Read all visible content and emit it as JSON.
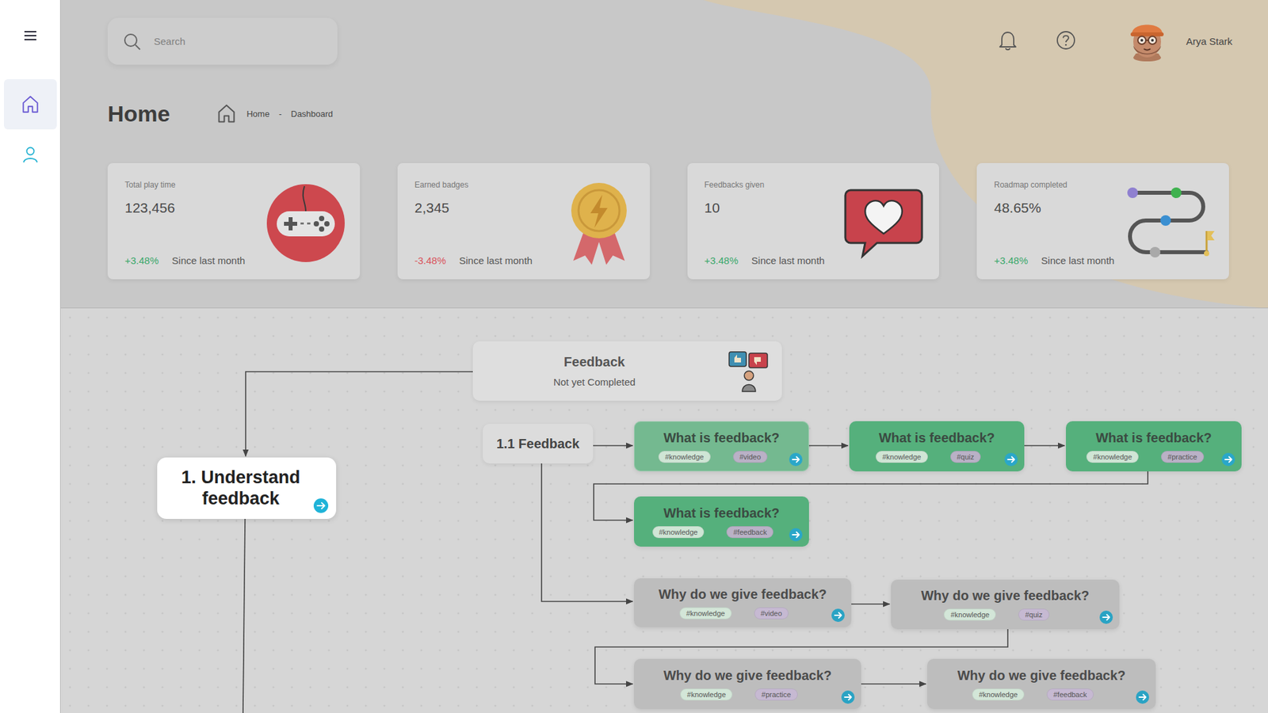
{
  "sidebar": {
    "items": [
      {
        "selected": true
      },
      {
        "selected": false
      }
    ]
  },
  "search": {
    "placeholder": "Search"
  },
  "user": {
    "name": "Arya Stark"
  },
  "page": {
    "title": "Home",
    "breadcrumb": [
      "Home",
      "-",
      "Dashboard"
    ]
  },
  "stats": [
    {
      "label": "Total play time",
      "value": "123,456",
      "change": "+3.48%",
      "trend": "up",
      "since": "Since last month"
    },
    {
      "label": "Earned badges",
      "value": "2,345",
      "change": "-3.48%",
      "trend": "down",
      "since": "Since last month"
    },
    {
      "label": "Feedbacks given",
      "value": "10",
      "change": "+3.48%",
      "trend": "up",
      "since": "Since last month"
    },
    {
      "label": "Roadmap completed",
      "value": "48.65%",
      "change": "+3.48%",
      "trend": "up",
      "since": "Since last month"
    }
  ],
  "roadmap": {
    "course": {
      "title": "Feedback",
      "status": "Not yet Completed"
    },
    "module": {
      "title": "1. Understand feedback",
      "selected": true
    },
    "section": {
      "title": "1.1 Feedback"
    },
    "steps": [
      {
        "title": "What is feedback?",
        "completed": true,
        "selected": true,
        "tags": [
          {
            "label": "#knowledge",
            "color": "#cfe5d5"
          },
          {
            "label": "#video",
            "color": "#b9b1c6"
          }
        ]
      },
      {
        "title": "What is feedback?",
        "completed": true,
        "selected": false,
        "tags": [
          {
            "label": "#knowledge",
            "color": "#cfe5d5"
          },
          {
            "label": "#quiz",
            "color": "#b9b1c6"
          }
        ]
      },
      {
        "title": "What is feedback?",
        "completed": true,
        "selected": false,
        "tags": [
          {
            "label": "#knowledge",
            "color": "#cfe5d5"
          },
          {
            "label": "#practice",
            "color": "#b9b1c6"
          }
        ]
      },
      {
        "title": "What is feedback?",
        "completed": true,
        "selected": false,
        "tags": [
          {
            "label": "#knowledge",
            "color": "#cfe5d5"
          },
          {
            "label": "#feedback",
            "color": "#b9b1c6"
          }
        ]
      },
      {
        "title": "Why do we give feedback?",
        "completed": false,
        "selected": false,
        "tags": [
          {
            "label": "#knowledge",
            "color": "#d3e6d8"
          },
          {
            "label": "#video",
            "color": "#c6b9d2"
          }
        ]
      },
      {
        "title": "Why do we give feedback?",
        "completed": false,
        "selected": false,
        "tags": [
          {
            "label": "#knowledge",
            "color": "#d3e6d8"
          },
          {
            "label": "#quiz",
            "color": "#c6b9d2"
          }
        ]
      },
      {
        "title": "Why do we give feedback?",
        "completed": false,
        "selected": false,
        "tags": [
          {
            "label": "#knowledge",
            "color": "#d3e6d8"
          },
          {
            "label": "#practice",
            "color": "#c6b9d2"
          }
        ]
      },
      {
        "title": "Why do we give feedback?",
        "completed": false,
        "selected": false,
        "tags": [
          {
            "label": "#knowledge",
            "color": "#d3e6d8"
          },
          {
            "label": "#feedback",
            "color": "#c6b9d2"
          }
        ]
      }
    ]
  }
}
